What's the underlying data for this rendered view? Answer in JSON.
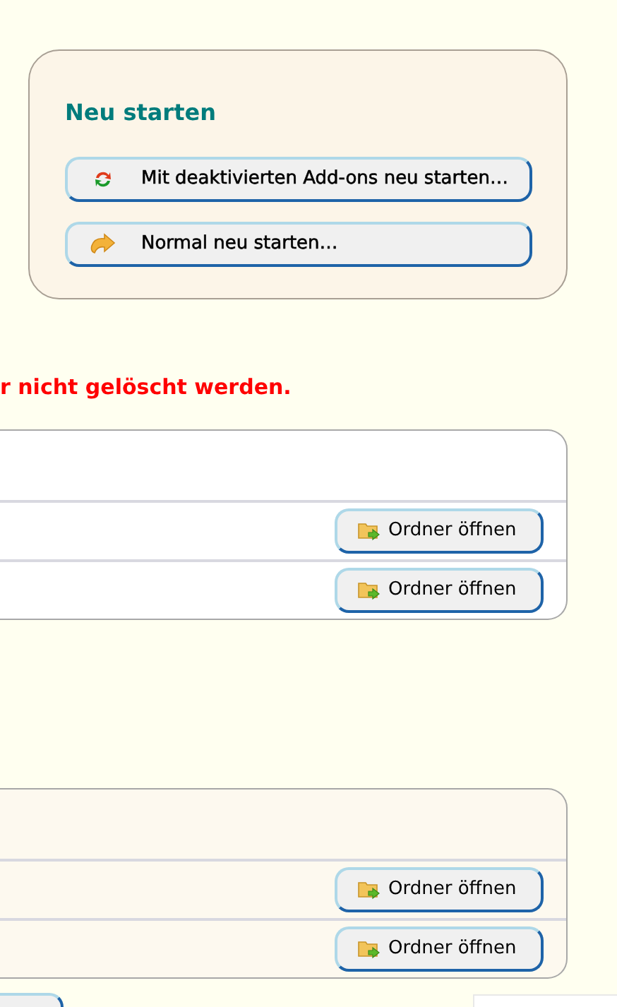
{
  "restart": {
    "title": "Neu starten",
    "buttons": [
      {
        "label": "Mit deaktivierten Add-ons neu starten…",
        "kind": "safe-mode"
      },
      {
        "label": "Normal neu starten…",
        "kind": "normal"
      }
    ]
  },
  "warning": "r nicht gelöscht werden.",
  "tables": [
    {
      "rows": [
        {
          "button": "Ordner öffnen"
        },
        {
          "button": "Ordner öffnen"
        }
      ]
    },
    {
      "rows": [
        {
          "button": "Ordner öffnen"
        },
        {
          "button": "Ordner öffnen"
        }
      ]
    }
  ]
}
